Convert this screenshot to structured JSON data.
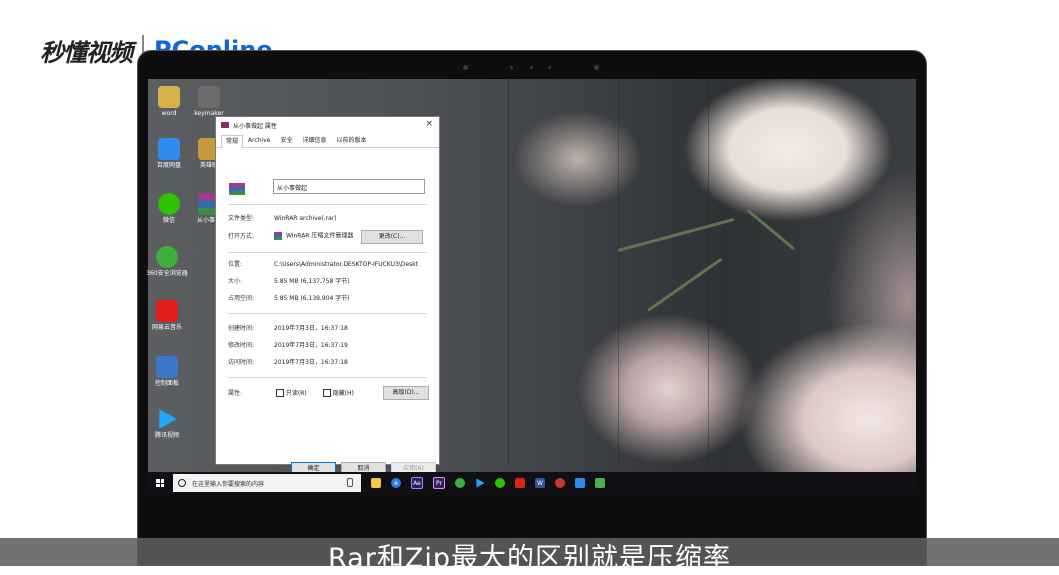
{
  "brand": {
    "left": "秒懂视频",
    "right": "PConline"
  },
  "desktop_icons": [
    {
      "label": "word",
      "icon": "word-doc-icon",
      "color": "#d9b14a"
    },
    {
      "label": "keymaker",
      "icon": "keymaker-icon",
      "color": "#6c6c6c"
    },
    {
      "label": "百度网盘",
      "icon": "baidu-netdisk-icon",
      "color": "#2f8df0"
    },
    {
      "label": "英雄联",
      "icon": "game-icon",
      "color": "#c49a3a"
    },
    {
      "label": "微信",
      "icon": "wechat-icon",
      "color": "#2dc100"
    },
    {
      "label": "从小事做",
      "icon": "winrar-archive-icon",
      "color": "#8b2a6a"
    },
    {
      "label": "360安全浏览器",
      "icon": "360-browser-icon",
      "color": "#3fae3a"
    },
    {
      "label": "网易云音乐",
      "icon": "netease-music-icon",
      "color": "#e0201b"
    },
    {
      "label": "控制面板",
      "icon": "control-panel-icon",
      "color": "#3a78c9"
    },
    {
      "label": "腾讯视频",
      "icon": "tencent-video-icon",
      "color": "#1ea7ff"
    }
  ],
  "dialog": {
    "title": "从小事做起 属性",
    "close": "×",
    "tabs": [
      "常规",
      "Archive",
      "安全",
      "详细信息",
      "以前的版本"
    ],
    "file_name": "从小事做起",
    "type_label": "文件类型:",
    "type_value": "WinRAR archive(.rar)",
    "open_label": "打开方式:",
    "open_value": "WinRAR 压缩文件管理器",
    "change_button": "更改(C)...",
    "location_label": "位置:",
    "location_value": "C:\\Users\\Administrator.DESKTOP-IFUCKU3\\Deskt",
    "size_label": "大小:",
    "size_value": "5.85 MB (6,137,758 字节)",
    "disk_label": "占用空间:",
    "disk_value": "5.85 MB (6,139,904 字节)",
    "created_label": "创建时间:",
    "created_value": "2019年7月3日，16:37:18",
    "modified_label": "修改时间:",
    "modified_value": "2019年7月3日，16:37:19",
    "accessed_label": "访问时间:",
    "accessed_value": "2019年7月3日，16:37:18",
    "attr_label": "属性:",
    "readonly": "只读(R)",
    "hidden": "隐藏(H)",
    "advanced": "高级(D)...",
    "ok": "确定",
    "cancel": "取消",
    "apply": "应用(A)"
  },
  "taskbar": {
    "search_placeholder": "在这里输入你要搜索的内容",
    "apps": [
      {
        "name": "file-explorer-icon",
        "color": "#f2c744",
        "glyph": ""
      },
      {
        "name": "edge-icon",
        "color": "#2c7be5",
        "glyph": "e"
      },
      {
        "name": "adobe-ae-icon",
        "color": "#2a1f5c",
        "glyph": "Ae"
      },
      {
        "name": "adobe-pr-icon",
        "color": "#3a1f5c",
        "glyph": "Pr"
      },
      {
        "name": "360-browser-icon",
        "color": "#3fae3a",
        "glyph": ""
      },
      {
        "name": "tencent-video-icon",
        "color": "#1ea7ff",
        "glyph": ""
      },
      {
        "name": "wechat-icon",
        "color": "#2dc100",
        "glyph": ""
      },
      {
        "name": "netease-music-icon",
        "color": "#e0201b",
        "glyph": ""
      },
      {
        "name": "word-icon",
        "color": "#2b579a",
        "glyph": "W"
      },
      {
        "name": "record-icon",
        "color": "#c0392b",
        "glyph": ""
      },
      {
        "name": "baidu-netdisk-icon",
        "color": "#2f8df0",
        "glyph": ""
      },
      {
        "name": "photo-icon",
        "color": "#4caf50",
        "glyph": ""
      }
    ]
  },
  "caption": "Rar和Zip最大的区别就是压缩率"
}
